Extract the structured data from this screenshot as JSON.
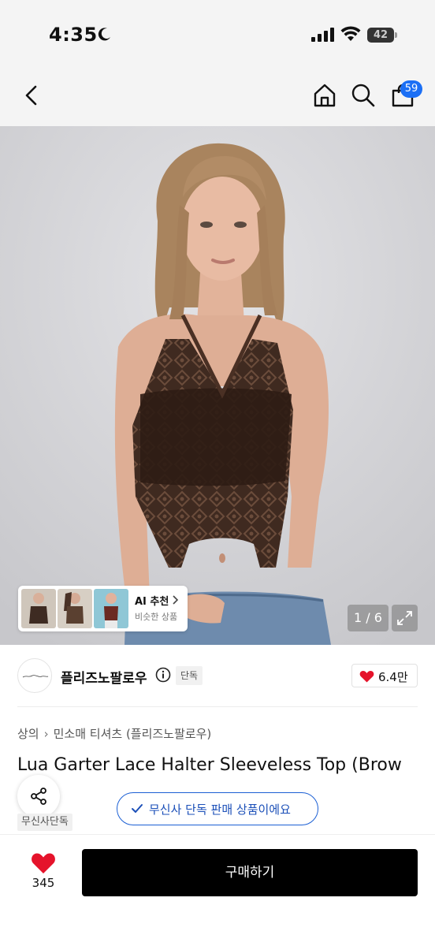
{
  "status_bar": {
    "time": "4:35",
    "battery": "42"
  },
  "nav": {
    "cart_count": "59"
  },
  "gallery": {
    "counter": "1 / 6",
    "ai": {
      "title": "AI 추천",
      "subtitle": "비슷한 상품"
    }
  },
  "brand": {
    "name": "플리즈노팔로우",
    "exclusive_label": "단독",
    "likes": "6.4만"
  },
  "breadcrumb": [
    "상의",
    "민소매 티셔츠 (플리즈노팔로우)"
  ],
  "product": {
    "title": "Lua Garter Lace Halter Sleeveless Top (Brow",
    "exclusive_notice": "무신사 단독 판매 상품이에요",
    "musinsa_tag": "무신사단독"
  },
  "bottom_bar": {
    "like_count": "345",
    "buy_label": "구매하기"
  },
  "colors": {
    "accent_blue": "#1b6ff5",
    "heart_red": "#e5132b",
    "buy_button": "#000000"
  }
}
